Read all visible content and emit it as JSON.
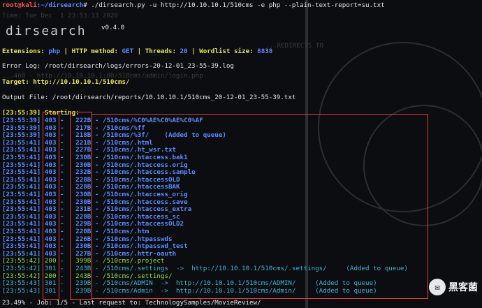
{
  "prompt": {
    "user_host": "root@kali",
    "path": ":~/dirsearch",
    "symbol": "#",
    "command": " ./dirsearch.py -u http://10.10.10.1/510cms -e php --plain-text-report=su.txt"
  },
  "ghost_time": "Time: Tue Dec  1 23:53:13 2020",
  "banner": {
    "logo": "dirsearch",
    "version": "v0.4.0"
  },
  "config": {
    "ext_label": "Extensions: ",
    "ext": "php",
    "method_label": " | HTTP method: ",
    "method": "GET",
    "threads_label": " | Threads: ",
    "threads": "20",
    "wordlist_label": " | Wordlist size: ",
    "wordlist": "8838"
  },
  "ghost_redirect": "...REDIRECTS TO",
  "error_log": "Error Log: /root/dirsearch/logs/errors-20-12-01_23-55-39.log",
  "ghost_login": "...468 - http://10.10.10.1:80/510cms/admin/login.php",
  "target": "Target: http://10.10.10.1/510cms/",
  "output_file": "Output File: /root/dirsearch/reports/10.10.10.1/510cms_20-12-01_23-55-39.txt",
  "starting": {
    "time": "[23:55:39]",
    "label": " Starting:"
  },
  "rows": [
    {
      "time": "[23:55:39]",
      "code": "403",
      "size": "222B",
      "path": "/510cms/%C0%AE%C0%AE%C0%AF",
      "note": "",
      "tone": "blue"
    },
    {
      "time": "[23:55:39]",
      "code": "403",
      "size": "217B",
      "path": "/510cms/%ff",
      "note": "",
      "tone": "blue"
    },
    {
      "time": "[23:55:39]",
      "code": "403",
      "size": "218B",
      "path": "/510cms/%3f/",
      "note": "    (Added to queue)",
      "tone": "blue"
    },
    {
      "time": "[23:55:41]",
      "code": "403",
      "size": "221B",
      "path": "/510cms/.html",
      "note": "",
      "tone": "blue"
    },
    {
      "time": "[23:55:41]",
      "code": "403",
      "size": "227B",
      "path": "/510cms/.ht_wsr.txt",
      "note": "",
      "tone": "blue"
    },
    {
      "time": "[23:55:41]",
      "code": "403",
      "size": "230B",
      "path": "/510cms/.htaccess.bak1",
      "note": "",
      "tone": "blue"
    },
    {
      "time": "[23:55:41]",
      "code": "403",
      "size": "230B",
      "path": "/510cms/.htaccess.orig",
      "note": "",
      "tone": "blue"
    },
    {
      "time": "[23:55:41]",
      "code": "403",
      "size": "232B",
      "path": "/510cms/.htaccess.sample",
      "note": "",
      "tone": "blue"
    },
    {
      "time": "[23:55:41]",
      "code": "403",
      "size": "228B",
      "path": "/510cms/.htaccessOLD",
      "note": "",
      "tone": "blue"
    },
    {
      "time": "[23:55:41]",
      "code": "403",
      "size": "228B",
      "path": "/510cms/.htaccessBAK",
      "note": "",
      "tone": "blue"
    },
    {
      "time": "[23:55:41]",
      "code": "403",
      "size": "230B",
      "path": "/510cms/.htaccess_orig",
      "note": "",
      "tone": "blue"
    },
    {
      "time": "[23:55:41]",
      "code": "403",
      "size": "230B",
      "path": "/510cms/.htaccess.save",
      "note": "",
      "tone": "blue"
    },
    {
      "time": "[23:55:41]",
      "code": "403",
      "size": "231B",
      "path": "/510cms/.htaccess_extra",
      "note": "",
      "tone": "blue"
    },
    {
      "time": "[23:55:41]",
      "code": "403",
      "size": "228B",
      "path": "/510cms/.htaccess_sc",
      "note": "",
      "tone": "blue"
    },
    {
      "time": "[23:55:41]",
      "code": "403",
      "size": "229B",
      "path": "/510cms/.htaccessOLD2",
      "note": "",
      "tone": "blue"
    },
    {
      "time": "[23:55:41]",
      "code": "403",
      "size": "220B",
      "path": "/510cms/.htm",
      "note": "",
      "tone": "blue"
    },
    {
      "time": "[23:55:41]",
      "code": "403",
      "size": "226B",
      "path": "/510cms/.htpasswds",
      "note": "",
      "tone": "blue"
    },
    {
      "time": "[23:55:41]",
      "code": "403",
      "size": "230B",
      "path": "/510cms/.htpasswd_test",
      "note": "",
      "tone": "blue"
    },
    {
      "time": "[23:55:41]",
      "code": "403",
      "size": "227B",
      "path": "/510cms/.httr-oauth",
      "note": "",
      "tone": "blue"
    },
    {
      "time": "[23:55:42]",
      "code": "200",
      "size": "399B",
      "path": "/510cms/.project",
      "note": "",
      "tone": "green"
    },
    {
      "time": "[23:55:42]",
      "code": "301",
      "size": "243B",
      "path": "/510cms/.settings",
      "note": "  ->  http://10.10.10.1/510cms/.settings/     (Added to queue)",
      "tone": "cyan"
    },
    {
      "time": "[23:55:42]",
      "code": "200",
      "size": "243B",
      "path": "/510cms/.settings/",
      "note": "",
      "tone": "green"
    },
    {
      "time": "[23:55:43]",
      "code": "301",
      "size": "239B",
      "path": "/510cms/ADMIN",
      "note": "  ->  http://10.10.10.1/510cms/ADMIN/     (Added to queue)",
      "tone": "cyan"
    },
    {
      "time": "[23:55:43]",
      "code": "301",
      "size": "239B",
      "path": "/510cms/Admin",
      "note": "  ->  http://10.10.10.1/510cms/Admin/     (Added to queue)",
      "tone": "cyan"
    }
  ],
  "progress": "23.49% - Job: 1/5 - Last request to: TechnologySamples/MovieReview/",
  "watermark": {
    "icon": "wechat-icon",
    "text": "黑客菌"
  }
}
